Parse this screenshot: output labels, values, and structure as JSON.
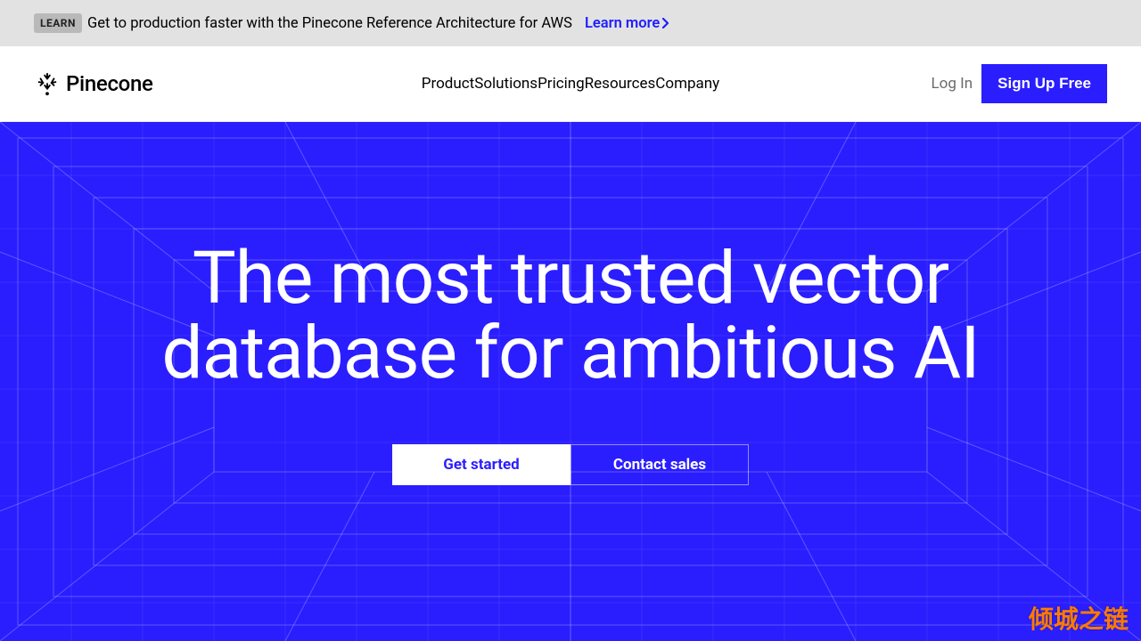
{
  "announce": {
    "badge": "LEARN",
    "text": "Get to production faster with the Pinecone Reference Architecture for AWS",
    "link": "Learn more"
  },
  "brand": {
    "name": "Pinecone"
  },
  "nav": {
    "items": [
      "Product",
      "Solutions",
      "Pricing",
      "Resources",
      "Company"
    ],
    "login": "Log In",
    "signup": "Sign Up Free"
  },
  "hero": {
    "title": "The most trusted vector database for ambitious AI",
    "cta_primary": "Get started",
    "cta_secondary": "Contact sales"
  },
  "watermark": "倾城之链",
  "colors": {
    "accent": "#2a1eff",
    "announce_bg": "#e2e2e2"
  }
}
